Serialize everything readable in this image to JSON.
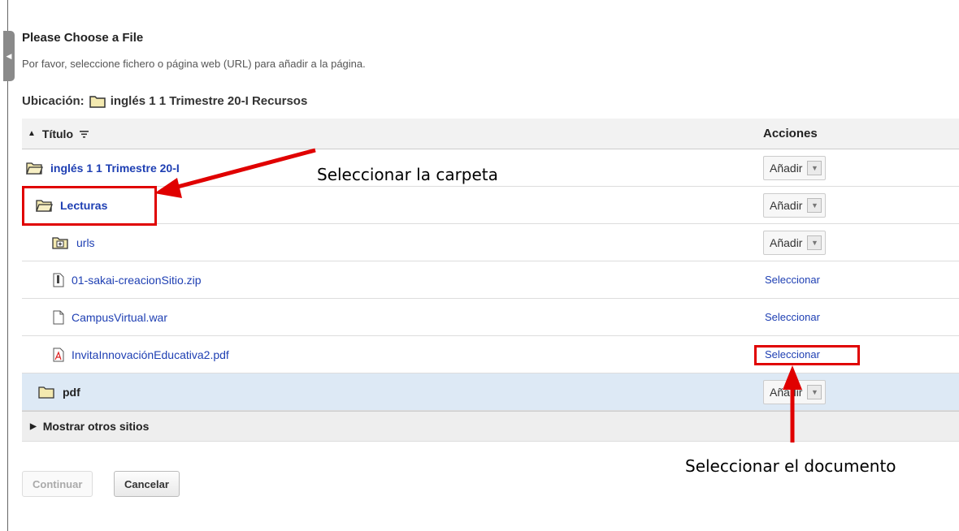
{
  "page": {
    "heading": "Please Choose a File",
    "instructions": "Por favor, seleccione fichero o página web (URL) para añadir a la página.",
    "location_label": "Ubicación:",
    "location_path": "inglés 1 1 Trimestre 20-I Recursos"
  },
  "table": {
    "title_header": "Título",
    "actions_header": "Acciones",
    "rows": [
      {
        "name": "inglés 1 1 Trimestre 20-I",
        "type": "folder-open",
        "action": "Añadir"
      },
      {
        "name": "Lecturas",
        "type": "folder-open",
        "action": "Añadir"
      },
      {
        "name": "urls",
        "type": "folder-plus",
        "action": "Añadir"
      },
      {
        "name": "01-sakai-creacionSitio.zip",
        "type": "zip",
        "action": "Seleccionar"
      },
      {
        "name": "CampusVirtual.war",
        "type": "file",
        "action": "Seleccionar"
      },
      {
        "name": "InvitaInnovaciónEducativa2.pdf",
        "type": "pdf",
        "action": "Seleccionar"
      },
      {
        "name": "pdf",
        "type": "folder",
        "action": "Añadir"
      }
    ],
    "other_sites": "Mostrar otros sitios"
  },
  "buttons": {
    "continue": "Continuar",
    "cancel": "Cancelar"
  },
  "annotations": {
    "folder_note": "Seleccionar la carpeta",
    "document_note": "Seleccionar el documento",
    "color": "#e00000"
  },
  "icons": {
    "collapse": "left-triangle-icon",
    "sort": "sort-arrows-icon",
    "filter": "filter-icon",
    "folder": "folder-icon",
    "zip": "zip-file-icon",
    "file": "file-icon",
    "pdf": "pdf-file-icon",
    "expand": "right-triangle-icon"
  }
}
